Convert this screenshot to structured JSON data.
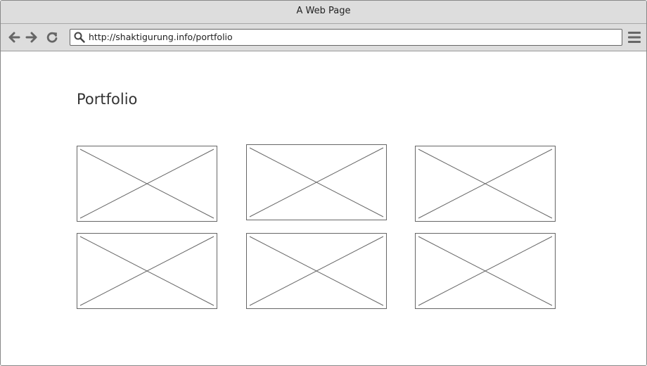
{
  "window": {
    "title": "A Web Page"
  },
  "toolbar": {
    "back_icon": "arrow-left-icon",
    "forward_icon": "arrow-right-icon",
    "reload_icon": "reload-icon",
    "search_icon": "search-icon",
    "menu_icon": "hamburger-menu-icon",
    "url": "http://shaktigurung.info/portfolio"
  },
  "page": {
    "title": "Portfolio",
    "portfolio_items": [
      {
        "type": "image-placeholder"
      },
      {
        "type": "image-placeholder"
      },
      {
        "type": "image-placeholder"
      },
      {
        "type": "image-placeholder"
      },
      {
        "type": "image-placeholder"
      },
      {
        "type": "image-placeholder"
      }
    ]
  },
  "colors": {
    "chrome": "#dddddd",
    "icon": "#666666",
    "border": "#888888",
    "text": "#333333"
  }
}
